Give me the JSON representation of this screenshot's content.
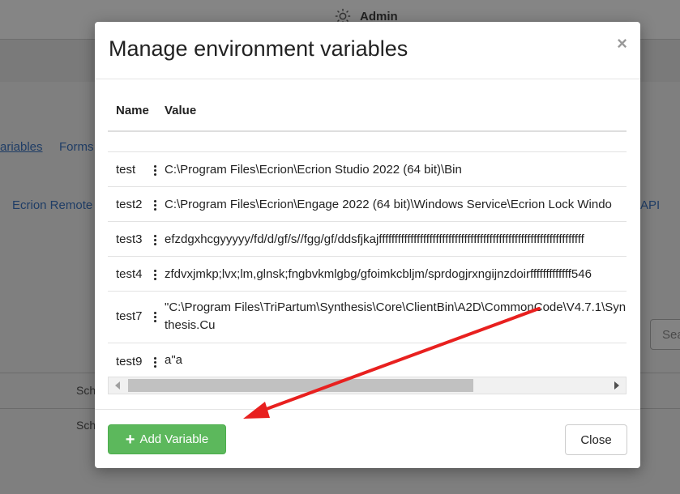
{
  "background": {
    "admin_label": "Admin",
    "links": [
      "ariables",
      "Forms",
      "Ecrion Remote",
      "API"
    ],
    "search_placeholder": "Sea",
    "schedule_items": [
      "Sch",
      "Sch"
    ]
  },
  "modal": {
    "title": "Manage environment variables",
    "close_symbol": "×",
    "columns": {
      "name": "Name",
      "value": "Value"
    },
    "rows": [
      {
        "name": "test",
        "value": "C:\\Program Files\\Ecrion\\Ecrion Studio 2022 (64 bit)\\Bin"
      },
      {
        "name": "test2",
        "value": "C:\\Program Files\\Ecrion\\Engage 2022 (64 bit)\\Windows Service\\Ecrion Lock Windo"
      },
      {
        "name": "test3",
        "value": "efzdgxhcgyyyyy/fd/d/gf/s//fgg/gf/ddsfjkajfffffffffffffffffffffffffffffffffffffffffffffffffffffffffffffffff"
      },
      {
        "name": "test4",
        "value": "zfdvxjmkp;lvx;lm,glnsk;fngbvkmlgbg/gfoimkcbljm/sprdogjrxngijnzdoirfffffffffffff546"
      },
      {
        "name": "test7",
        "value": "\"C:\\Program Files\\TriPartum\\Synthesis\\Core\\ClientBin\\A2D\\CommonCode\\V4.7.1\\Synthesis.Cu"
      },
      {
        "name": "test9",
        "value": "a\"a"
      }
    ],
    "add_button_label": "Add Variable",
    "close_button_label": "Close"
  },
  "colors": {
    "add_button": "#5cb85c",
    "annotation_arrow": "#e8201f"
  }
}
